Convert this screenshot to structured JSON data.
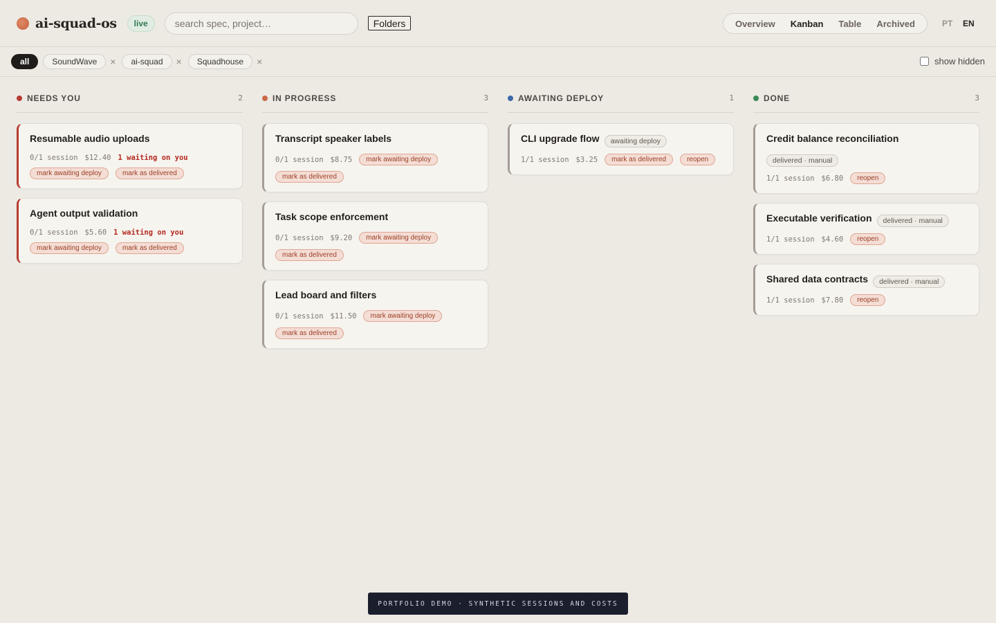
{
  "header": {
    "app_name": "ai-squad-os",
    "live_badge": "live",
    "search_placeholder": "search spec, project…",
    "folders_label": "Folders",
    "views": [
      "Overview",
      "Kanban",
      "Table",
      "Archived"
    ],
    "active_view": "Kanban",
    "lang_pt": "PT",
    "lang_en": "EN"
  },
  "filters": {
    "all_label": "all",
    "chips": [
      "SoundWave",
      "ai-squad",
      "Squadhouse"
    ],
    "remove_glyph": "×",
    "show_hidden_label": "show hidden"
  },
  "columns": [
    {
      "title": "NEEDS YOU",
      "count": "2",
      "color": "#b53b30",
      "cards": [
        {
          "title": "Resumable audio uploads",
          "session": "0/1 session",
          "cost": "$12.40",
          "waiting": "1 waiting on you",
          "btn1": "mark awaiting deploy",
          "btn2": "mark as delivered"
        },
        {
          "title": "Agent output validation",
          "session": "0/1 session",
          "cost": "$5.60",
          "waiting": "1 waiting on you",
          "btn1": "mark awaiting deploy",
          "btn2": "mark as delivered"
        }
      ]
    },
    {
      "title": "IN PROGRESS",
      "count": "3",
      "color": "#c96a45",
      "cards": [
        {
          "title": "Transcript speaker labels",
          "session": "0/1 session",
          "cost": "$8.75",
          "btn1": "mark awaiting deploy",
          "btn2": "mark as delivered"
        },
        {
          "title": "Task scope enforcement",
          "session": "0/1 session",
          "cost": "$9.20",
          "btn1": "mark awaiting deploy",
          "btn2": "mark as delivered"
        },
        {
          "title": "Lead board and filters",
          "session": "0/1 session",
          "cost": "$11.50",
          "btn1": "mark awaiting deploy",
          "btn2": "mark as delivered"
        }
      ]
    },
    {
      "title": "AWAITING DEPLOY",
      "count": "1",
      "color": "#3d6aa8",
      "cards": [
        {
          "title": "CLI upgrade flow",
          "tag": "awaiting deploy",
          "session": "1/1 session",
          "cost": "$3.25",
          "btn1": "mark as delivered",
          "btn2": "reopen"
        }
      ]
    },
    {
      "title": "DONE",
      "count": "3",
      "color": "#3b8a5a",
      "cards": [
        {
          "title": "Credit balance reconciliation",
          "tag": "delivered · manual",
          "session": "1/1 session",
          "cost": "$6.80",
          "btn1": "reopen"
        },
        {
          "title": "Executable verification",
          "tag": "delivered · manual",
          "session": "1/1 session",
          "cost": "$4.60",
          "btn1": "reopen"
        },
        {
          "title": "Shared data contracts",
          "tag": "delivered · manual",
          "session": "1/1 session",
          "cost": "$7.80",
          "btn1": "reopen"
        }
      ]
    }
  ],
  "footer": {
    "note": "PORTFOLIO DEMO · SYNTHETIC SESSIONS AND COSTS"
  }
}
